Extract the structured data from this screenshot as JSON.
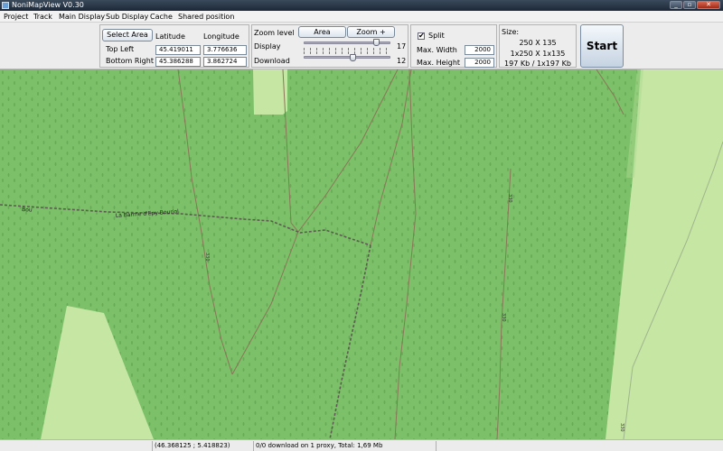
{
  "window": {
    "title": "NoniMapView V0.30",
    "controls": [
      "minimize-icon",
      "maximize-icon",
      "close-icon"
    ]
  },
  "menu": {
    "items": [
      "Project",
      "Track",
      "Main Display",
      "Sub Display",
      "Cache",
      "Shared position"
    ]
  },
  "area_panel": {
    "select_area_label": "Select Area",
    "latitude_header": "Latitude",
    "longitude_header": "Longitude",
    "top_left_label": "Top Left",
    "bottom_right_label": "Bottom Right",
    "top_left_lat": "45.419011",
    "top_left_lon": "3.776636",
    "bottom_right_lat": "45.386288",
    "bottom_right_lon": "3.862724"
  },
  "zoom_panel": {
    "zoom_level_label": "Zoom level",
    "area_button": "Area",
    "zoom_plus_button": "Zoom +",
    "display_label": "Display",
    "display_value": "17",
    "download_label": "Download",
    "download_value": "12"
  },
  "split_panel": {
    "split_label": "Split",
    "split_checked": true,
    "split_check_glyph": "✔",
    "max_width_label": "Max. Width",
    "max_width_value": "2000",
    "max_height_label": "Max. Height",
    "max_height_value": "2000"
  },
  "size_panel": {
    "size_label": "Size:",
    "line1": "250 X 135",
    "line2": "1x250 X 1x135",
    "line3": "197 Kb / 1x197 Kb"
  },
  "start_button": "Start",
  "map": {
    "labels": {
      "road_name": "La Barme d'Epy Bouriol",
      "road_name_left": "Bou",
      "track_marker_1": "330",
      "track_marker_2": "330",
      "track_marker_3": "330",
      "track_marker_4": "330"
    },
    "colors": {
      "forest": "#7cc069",
      "meadow": "#c6e6a4",
      "track": "#7a6a55",
      "road": "#5e5a52"
    }
  },
  "status": {
    "coords": "(46.368125 ; 5.418823)",
    "download_info": "0/0 download on 1 proxy, Total: 1,69 Mb"
  }
}
